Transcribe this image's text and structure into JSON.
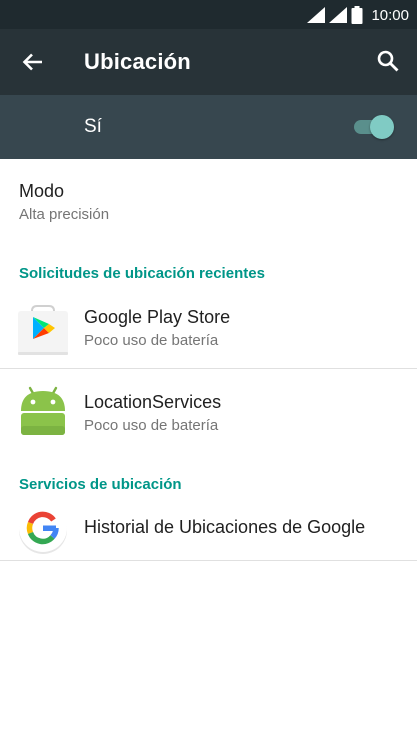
{
  "status_bar": {
    "time": "10:00",
    "icons": [
      "signal-icon",
      "signal-icon",
      "battery-icon"
    ]
  },
  "app_bar": {
    "title": "Ubicación",
    "back_icon": "arrow-left-icon",
    "search_icon": "search-icon"
  },
  "master_switch": {
    "label": "Sí",
    "state": "on",
    "color": "#80cbc4"
  },
  "mode": {
    "title": "Modo",
    "value": "Alta precisión"
  },
  "recent_requests": {
    "header": "Solicitudes de ubicación recientes",
    "items": [
      {
        "name": "Google Play Store",
        "detail": "Poco uso de batería",
        "icon": "google-play-store-icon"
      },
      {
        "name": "LocationServices",
        "detail": "Poco uso de batería",
        "icon": "android-icon"
      }
    ]
  },
  "location_services": {
    "header": "Servicios de ubicación",
    "items": [
      {
        "name": "Historial de Ubicaciones de Google",
        "icon": "google-g-icon"
      }
    ]
  },
  "colors": {
    "accent": "#009688",
    "app_bar": "#283338",
    "master_bar": "#37474f",
    "status_bar": "#1f2a2f"
  }
}
